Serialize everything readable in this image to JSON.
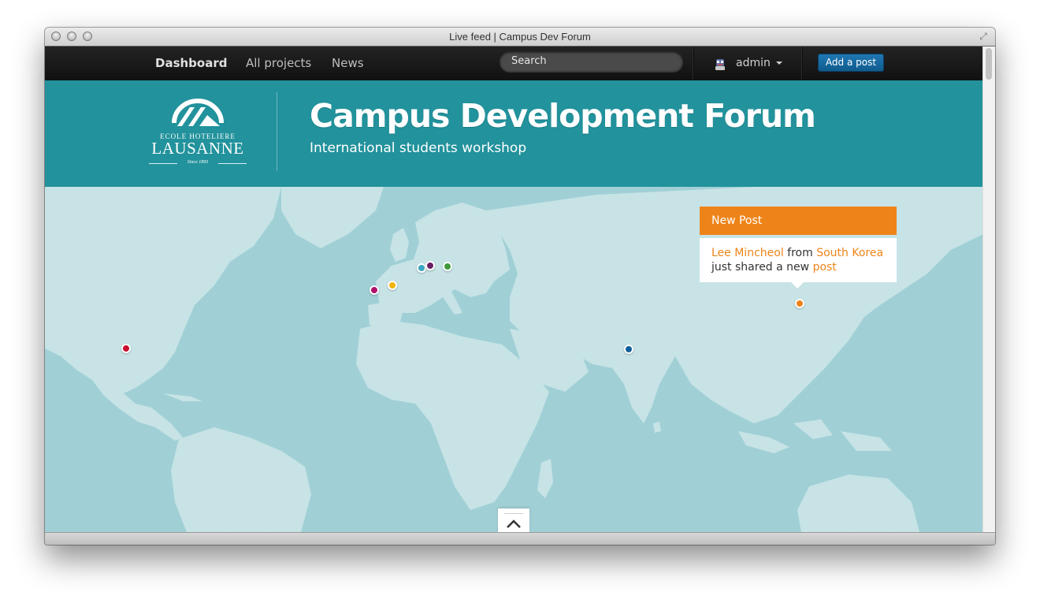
{
  "window": {
    "title": "Live feed | Campus Dev Forum"
  },
  "nav": {
    "links": [
      "Dashboard",
      "All projects",
      "News"
    ],
    "search_placeholder": "Search",
    "user": "admin",
    "add_post_label": "Add a post"
  },
  "header": {
    "logo_line1": "ECOLE HOTELIERE",
    "logo_line2": "LAUSANNE",
    "logo_line3": "Since 1893",
    "title": "Campus Development Forum",
    "subtitle": "International students workshop"
  },
  "popup": {
    "heading": "New Post",
    "author": "Lee Mincheol",
    "from_text": "from",
    "country": "South Korea",
    "middle_text": "just shared a new",
    "link_text": "post"
  },
  "pins": [
    {
      "color": "#c8102e"
    },
    {
      "color": "#b0126b"
    },
    {
      "color": "#f1b410"
    },
    {
      "color": "#3aa6c2"
    },
    {
      "color": "#6a1f63"
    },
    {
      "color": "#3f9a3a"
    },
    {
      "color": "#0f5f9c"
    },
    {
      "color": "#ee8419"
    }
  ],
  "colors": {
    "accent": "#ee8419",
    "header_bg": "#22929c",
    "map_water": "#a0d0d6",
    "map_land": "#c7e3e6",
    "button": "#1a6fa8"
  }
}
